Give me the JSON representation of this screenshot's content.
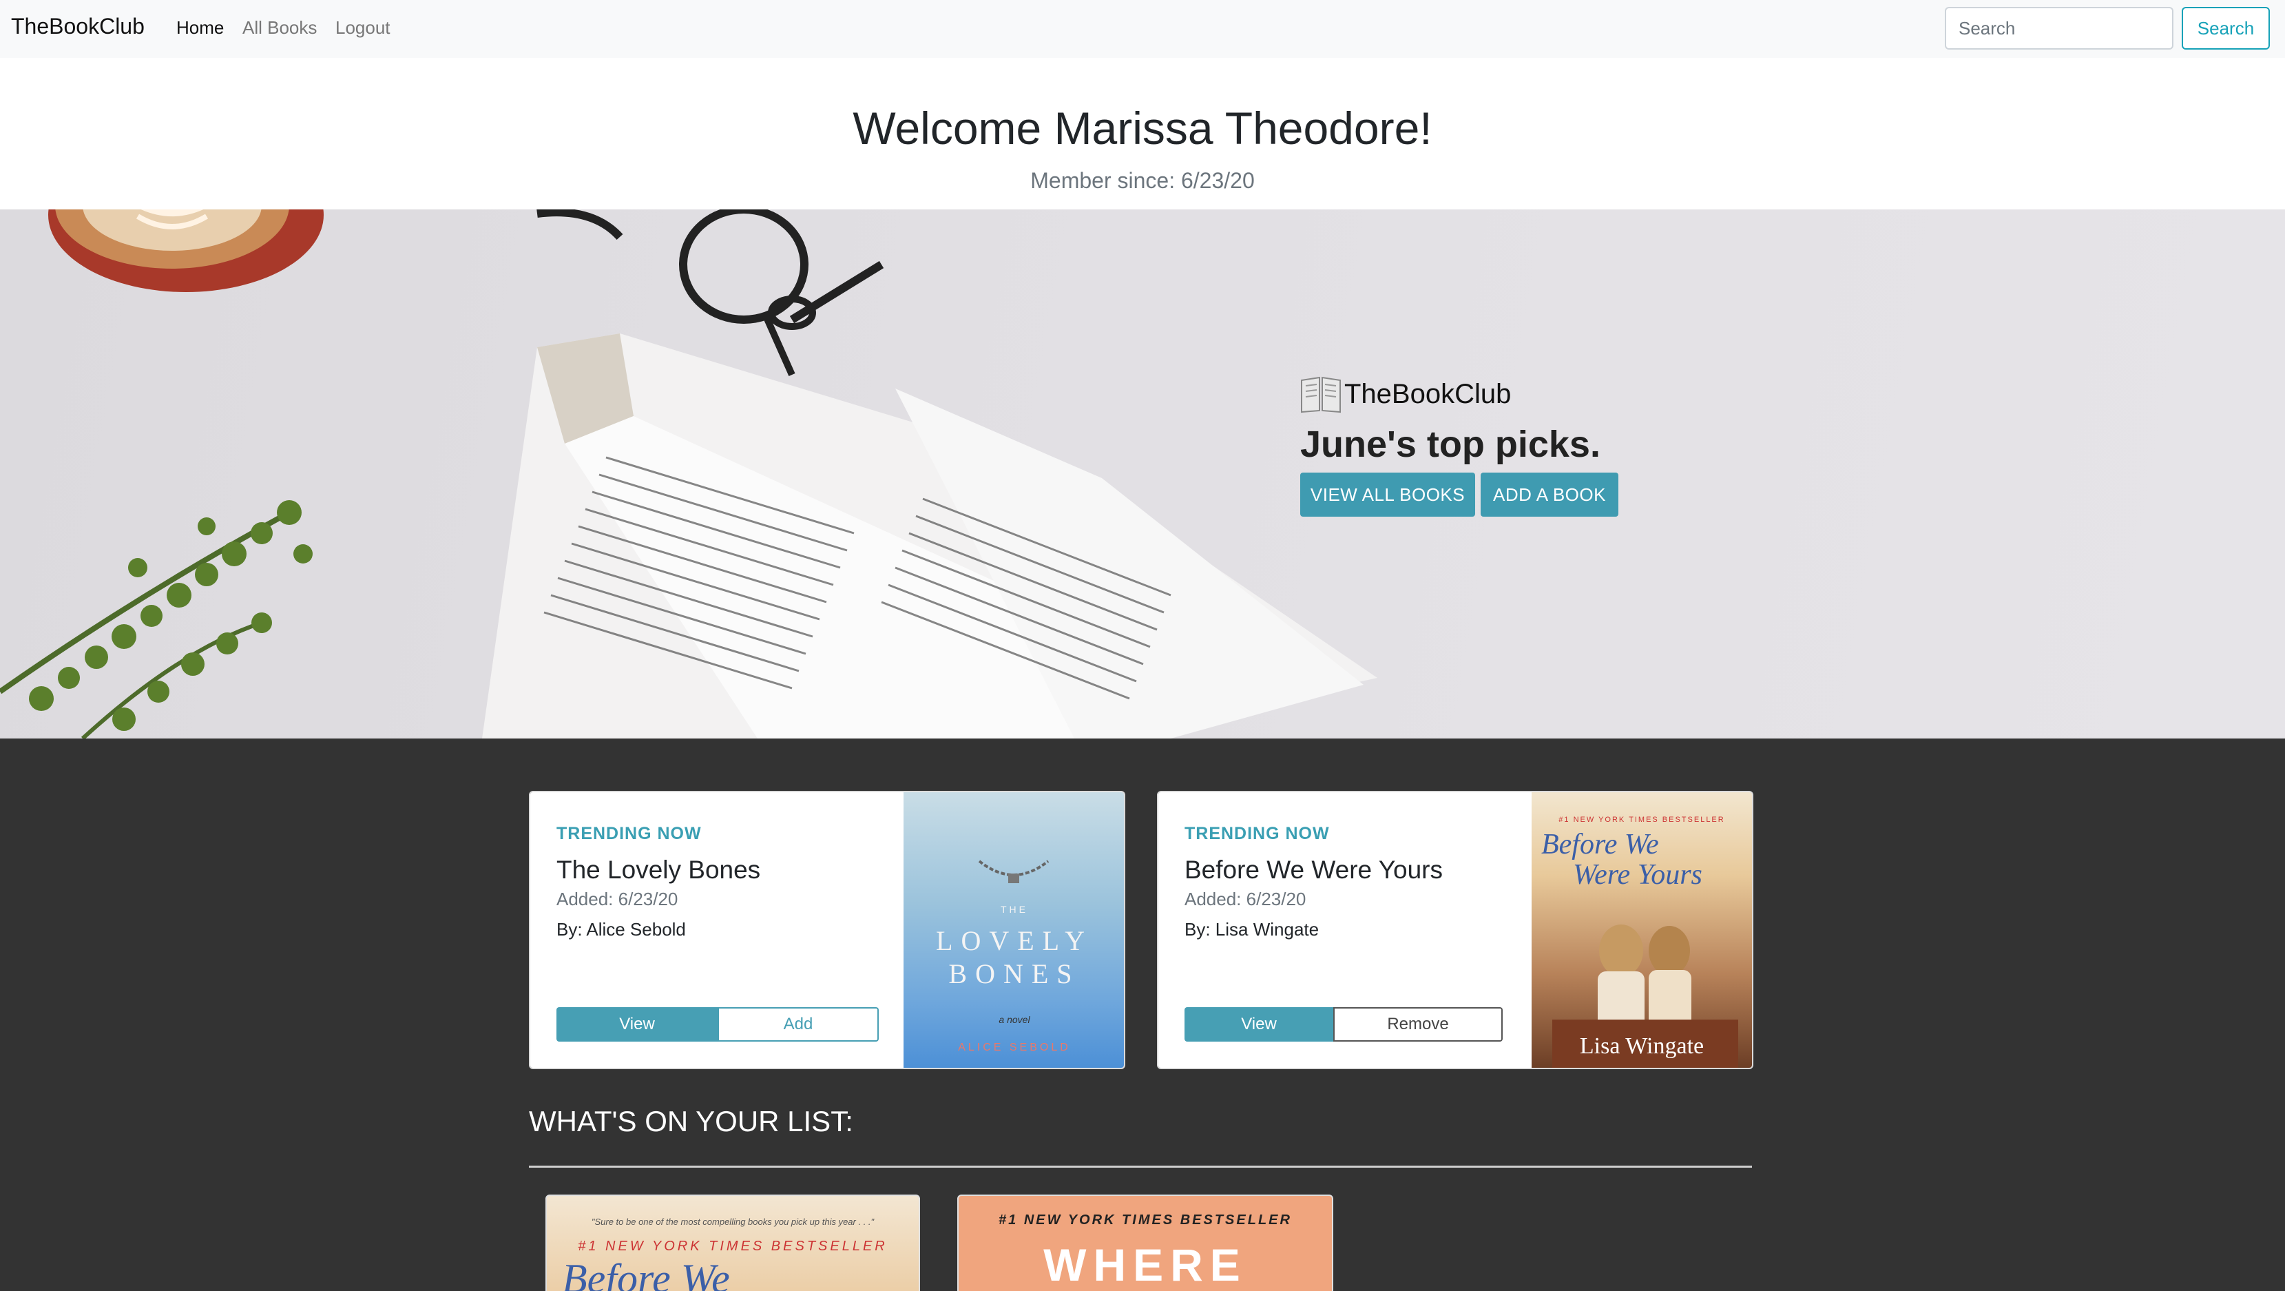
{
  "navbar": {
    "brand": "TheBookClub",
    "links": [
      {
        "label": "Home",
        "active": true
      },
      {
        "label": "All Books",
        "active": false
      },
      {
        "label": "Logout",
        "active": false
      }
    ],
    "search_placeholder": "Search",
    "search_button": "Search"
  },
  "welcome": {
    "heading": "Welcome Marissa Theodore!",
    "member_since": "Member since: 6/23/20"
  },
  "hero": {
    "brand": "TheBookClub",
    "title": "June's top picks.",
    "buttons": [
      "VIEW ALL BOOKS",
      "ADD A BOOK"
    ]
  },
  "trending": [
    {
      "badge": "TRENDING NOW",
      "title": "The Lovely Bones",
      "added": "Added: 6/23/20",
      "author": "By: Alice Sebold",
      "primary_action": "View",
      "secondary_action": "Add",
      "cover": {
        "line1": "THE",
        "line2": "LOVELY",
        "line3": "BONES",
        "tag": "a novel",
        "author": "ALICE SEBOLD"
      }
    },
    {
      "badge": "TRENDING NOW",
      "title": "Before We Were Yours",
      "added": "Added: 6/23/20",
      "author": "By: Lisa Wingate",
      "primary_action": "View",
      "secondary_action": "Remove",
      "cover": {
        "top": "#1 NEW YORK TIMES BESTSELLER",
        "title1": "Before We",
        "title2": "Were Yours",
        "author": "Lisa Wingate"
      }
    }
  ],
  "list": {
    "heading": "WHAT'S ON YOUR LIST:",
    "items": [
      {
        "top": "#1 NEW YORK TIMES BESTSELLER",
        "title": "Before We"
      },
      {
        "top": "#1 NEW YORK TIMES BESTSELLER",
        "title": "WHERE"
      }
    ]
  },
  "colors": {
    "accent": "#17a2b8",
    "button_fill": "#479fb4",
    "dark_bg": "#333333"
  }
}
